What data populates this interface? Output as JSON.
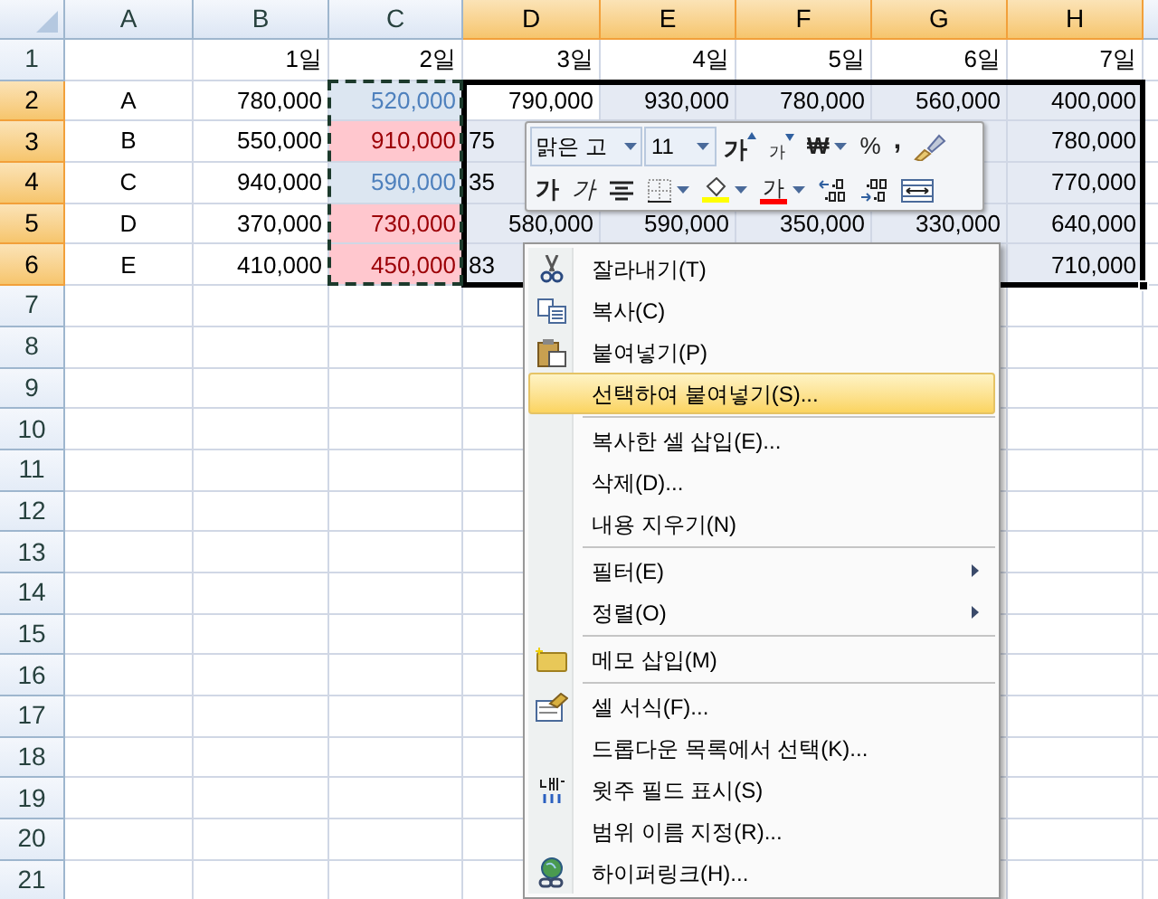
{
  "columns": [
    {
      "label": "A",
      "selected": false
    },
    {
      "label": "B",
      "selected": false
    },
    {
      "label": "C",
      "selected": false
    },
    {
      "label": "D",
      "selected": true
    },
    {
      "label": "E",
      "selected": true
    },
    {
      "label": "F",
      "selected": true
    },
    {
      "label": "G",
      "selected": true
    },
    {
      "label": "H",
      "selected": true
    }
  ],
  "rows": [
    {
      "label": "1",
      "selected": false,
      "cells": [
        {},
        {
          "text": "1일"
        },
        {
          "text": "2일"
        },
        {
          "text": "3일"
        },
        {
          "text": "4일"
        },
        {
          "text": "5일"
        },
        {
          "text": "6일"
        },
        {
          "text": "7일"
        }
      ]
    },
    {
      "label": "2",
      "selected": true,
      "cells": [
        {
          "text": "A"
        },
        {
          "text": "780,000"
        },
        {
          "text": "520,000",
          "kind": "low",
          "copied": true
        },
        {
          "text": "790,000",
          "active": true
        },
        {
          "text": "930,000"
        },
        {
          "text": "780,000"
        },
        {
          "text": "560,000"
        },
        {
          "text": "400,000"
        }
      ]
    },
    {
      "label": "3",
      "selected": true,
      "cells": [
        {
          "text": "B"
        },
        {
          "text": "550,000"
        },
        {
          "text": "910,000",
          "kind": "high",
          "copied": true
        },
        {
          "text": "75",
          "cut": true
        },
        {},
        {},
        {},
        {
          "text": "780,000"
        }
      ]
    },
    {
      "label": "4",
      "selected": true,
      "cells": [
        {
          "text": "C"
        },
        {
          "text": "940,000"
        },
        {
          "text": "590,000",
          "kind": "low",
          "copied": true
        },
        {
          "text": "35",
          "cut": true
        },
        {},
        {},
        {},
        {
          "text": "770,000"
        }
      ]
    },
    {
      "label": "5",
      "selected": true,
      "cells": [
        {
          "text": "D"
        },
        {
          "text": "370,000"
        },
        {
          "text": "730,000",
          "kind": "high",
          "copied": true
        },
        {
          "text": "580,000"
        },
        {
          "text": "590,000"
        },
        {
          "text": "350,000"
        },
        {
          "text": "330,000"
        },
        {
          "text": "640,000"
        }
      ]
    },
    {
      "label": "6",
      "selected": true,
      "cells": [
        {
          "text": "E"
        },
        {
          "text": "410,000"
        },
        {
          "text": "450,000",
          "kind": "high",
          "copied": true
        },
        {
          "text": "83",
          "cut": true
        },
        {},
        {},
        {},
        {
          "text": "710,000"
        }
      ]
    },
    {
      "label": "7",
      "selected": false
    },
    {
      "label": "8",
      "selected": false
    },
    {
      "label": "9",
      "selected": false
    },
    {
      "label": "10",
      "selected": false
    },
    {
      "label": "11",
      "selected": false
    },
    {
      "label": "12",
      "selected": false
    },
    {
      "label": "13",
      "selected": false
    },
    {
      "label": "14",
      "selected": false
    },
    {
      "label": "15",
      "selected": false
    },
    {
      "label": "16",
      "selected": false
    },
    {
      "label": "17",
      "selected": false
    },
    {
      "label": "18",
      "selected": false
    },
    {
      "label": "19",
      "selected": false
    },
    {
      "label": "20",
      "selected": false
    },
    {
      "label": "21",
      "selected": false
    }
  ],
  "mini_toolbar": {
    "font": "맑은 고",
    "size": "11",
    "row_1": [
      {
        "kind": "grow",
        "label": "가"
      },
      {
        "kind": "shrink",
        "label": "가"
      },
      {
        "kind": "currency",
        "label": "₩"
      },
      {
        "kind": "percent",
        "label": "%"
      },
      {
        "kind": "comma",
        "label": ","
      },
      {
        "kind": "painter"
      }
    ],
    "row_2": [
      {
        "kind": "bold",
        "label": "가"
      },
      {
        "kind": "italic",
        "label": "가"
      },
      {
        "kind": "center"
      },
      {
        "kind": "borders"
      },
      {
        "kind": "fill",
        "color": "#ffff00"
      },
      {
        "kind": "font_color",
        "label": "가",
        "color": "#ff0000"
      },
      {
        "kind": "inc_decimal"
      },
      {
        "kind": "dec_decimal"
      },
      {
        "kind": "merge"
      }
    ]
  },
  "context_menu": [
    [
      {
        "label": "잘라내기(T)",
        "kind": "cut",
        "selected": false,
        "submenu": false
      },
      {
        "label": "복사(C)",
        "kind": "copy",
        "selected": false,
        "submenu": false
      },
      {
        "label": "붙여넣기(P)",
        "kind": "paste",
        "selected": false,
        "submenu": false
      },
      {
        "label": "선택하여 붙여넣기(S)...",
        "selected": true,
        "submenu": false
      }
    ],
    [
      {
        "label": "복사한 셀 삽입(E)...",
        "selected": false,
        "submenu": false
      },
      {
        "label": "삭제(D)...",
        "selected": false,
        "submenu": false
      },
      {
        "label": "내용 지우기(N)",
        "selected": false,
        "submenu": false
      }
    ],
    [
      {
        "label": "필터(E)",
        "selected": false,
        "submenu": true
      },
      {
        "label": "정렬(O)",
        "selected": false,
        "submenu": true
      }
    ],
    [
      {
        "label": "메모 삽입(M)",
        "kind": "comment",
        "selected": false,
        "submenu": false
      }
    ],
    [
      {
        "label": "셀 서식(F)...",
        "kind": "format",
        "selected": false,
        "submenu": false
      },
      {
        "label": "드롭다운 목록에서 선택(K)...",
        "selected": false,
        "submenu": false
      },
      {
        "label": "윗주 필드 표시(S)",
        "kind": "phonetic",
        "selected": false,
        "submenu": false
      },
      {
        "label": "범위 이름 지정(R)...",
        "selected": false,
        "submenu": false
      },
      {
        "label": "하이퍼링크(H)...",
        "kind": "link",
        "selected": false,
        "submenu": false
      }
    ]
  ]
}
